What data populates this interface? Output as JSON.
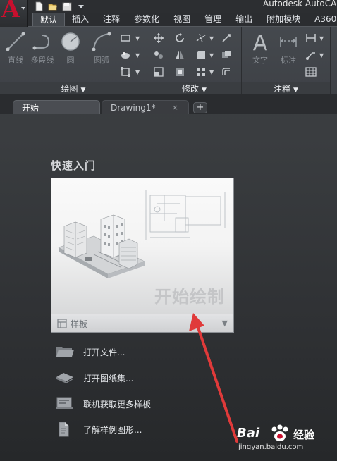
{
  "app": {
    "logo_letter": "A",
    "title": "Autodesk AutoCA"
  },
  "ribbon_tabs": [
    {
      "label": "默认",
      "active": true
    },
    {
      "label": "插入"
    },
    {
      "label": "注释"
    },
    {
      "label": "参数化"
    },
    {
      "label": "视图"
    },
    {
      "label": "管理"
    },
    {
      "label": "输出"
    },
    {
      "label": "附加模块"
    },
    {
      "label": "A360"
    }
  ],
  "ribbon": {
    "draw_tools": {
      "line": "直线",
      "polyline": "多段线",
      "circle": "圆",
      "arc": "圆弧"
    },
    "annotation_tools": {
      "text": "文字",
      "dimension": "标注"
    },
    "panels": {
      "draw": "绘图",
      "modify": "修改",
      "annotate": "注释"
    }
  },
  "doc_tabs": [
    {
      "label": "开始",
      "active": true
    },
    {
      "label": "Drawing1*",
      "close": "×"
    }
  ],
  "new_tab_symbol": "+",
  "start": {
    "quick_start_title": "快速入门",
    "card_label": "开始绘制",
    "template_label": "样板",
    "links": [
      {
        "label": "打开文件...",
        "icon": "folder-icon"
      },
      {
        "label": "打开图纸集...",
        "icon": "sheetset-icon"
      },
      {
        "label": "联机获取更多样板",
        "icon": "online-templates-icon"
      },
      {
        "label": "了解样例图形...",
        "icon": "sample-drawings-icon"
      }
    ]
  },
  "watermark": {
    "brand": "Bai",
    "brand_suffix": "经验",
    "url": "jingyan.baidu.com"
  },
  "colors": {
    "accent_red": "#c8102e",
    "arrow_red": "#e03a3a",
    "bg_top": "#3c3f43",
    "bg_bottom": "#26282a"
  }
}
